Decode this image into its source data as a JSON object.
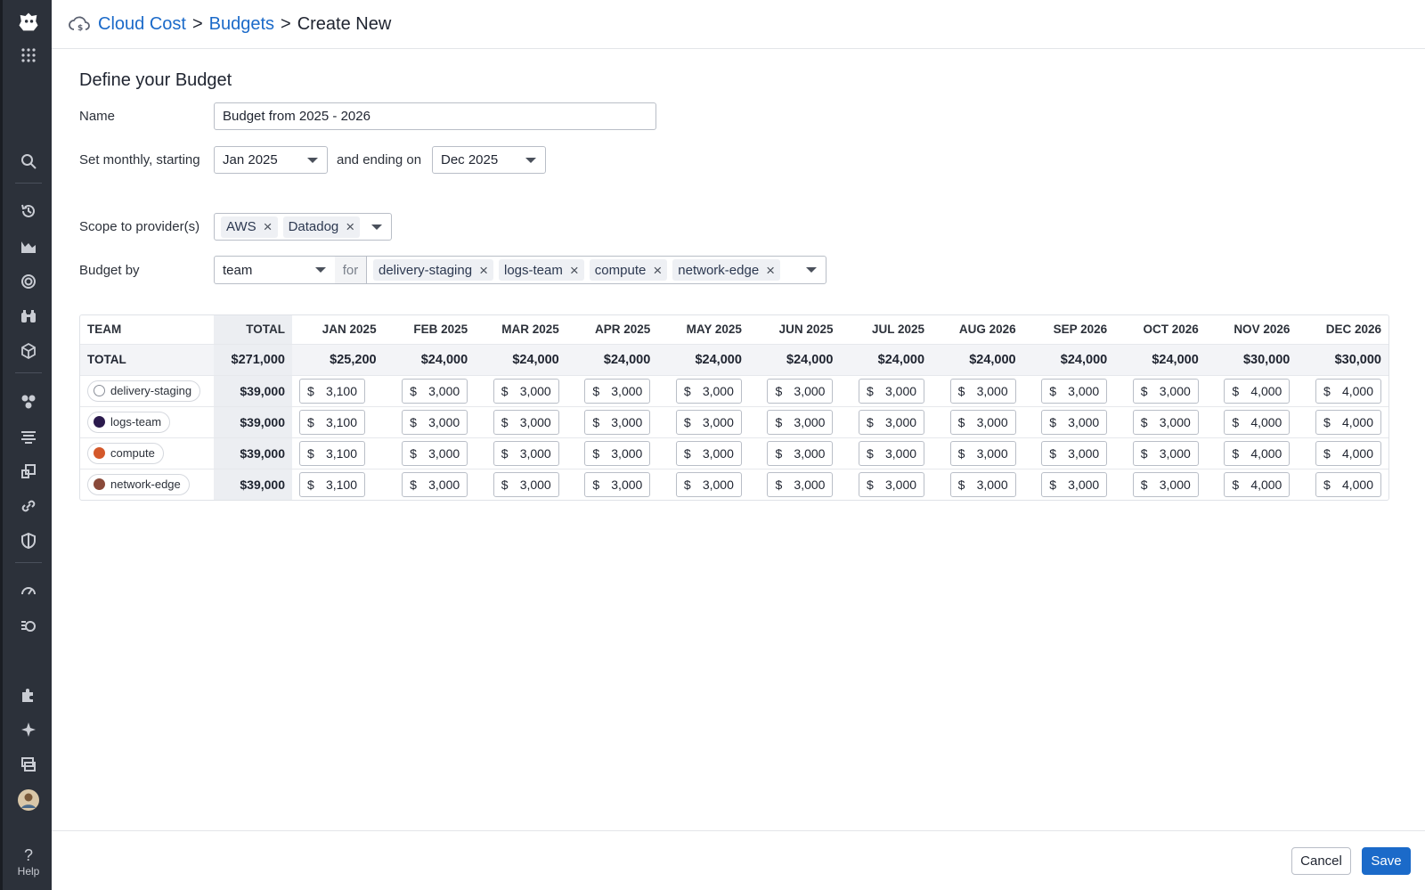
{
  "breadcrumb": {
    "root": "Cloud Cost",
    "parent": "Budgets",
    "current": "Create New",
    "separator": ">"
  },
  "form": {
    "heading": "Define your Budget",
    "name_label": "Name",
    "name_value": "Budget from 2025 - 2026",
    "monthly_label": "Set monthly, starting",
    "start_value": "Jan 2025",
    "ending_label": "and ending on",
    "end_value": "Dec 2025",
    "scope_label": "Scope to provider(s)",
    "providers": [
      "AWS",
      "Datadog"
    ],
    "budget_by_label": "Budget by",
    "budget_by_value": "team",
    "for_label": "for",
    "teams": [
      "delivery-staging",
      "logs-team",
      "compute",
      "network-edge"
    ]
  },
  "table": {
    "team_header": "TEAM",
    "total_header": "TOTAL",
    "months": [
      "JAN 2025",
      "FEB 2025",
      "MAR 2025",
      "APR 2025",
      "MAY 2025",
      "JUN 2025",
      "JUL 2025",
      "AUG 2026",
      "SEP 2026",
      "OCT 2026",
      "NOV 2026",
      "DEC 2026"
    ],
    "total_row": {
      "label": "TOTAL",
      "total": "$271,000",
      "values": [
        "$25,200",
        "$24,000",
        "$24,000",
        "$24,000",
        "$24,000",
        "$24,000",
        "$24,000",
        "$24,000",
        "$24,000",
        "$24,000",
        "$30,000",
        "$30,000"
      ]
    },
    "currency": "$",
    "rows": [
      {
        "team": "delivery-staging",
        "color": "#ffffff",
        "total": "$39,000",
        "values": [
          "3,100",
          "3,000",
          "3,000",
          "3,000",
          "3,000",
          "3,000",
          "3,000",
          "3,000",
          "3,000",
          "3,000",
          "4,000",
          "4,000"
        ]
      },
      {
        "team": "logs-team",
        "color": "#2b1a4d",
        "total": "$39,000",
        "values": [
          "3,100",
          "3,000",
          "3,000",
          "3,000",
          "3,000",
          "3,000",
          "3,000",
          "3,000",
          "3,000",
          "3,000",
          "4,000",
          "4,000"
        ]
      },
      {
        "team": "compute",
        "color": "#d4582a",
        "total": "$39,000",
        "values": [
          "3,100",
          "3,000",
          "3,000",
          "3,000",
          "3,000",
          "3,000",
          "3,000",
          "3,000",
          "3,000",
          "3,000",
          "4,000",
          "4,000"
        ]
      },
      {
        "team": "network-edge",
        "color": "#8a4a3a",
        "total": "$39,000",
        "values": [
          "3,100",
          "3,000",
          "3,000",
          "3,000",
          "3,000",
          "3,000",
          "3,000",
          "3,000",
          "3,000",
          "3,000",
          "4,000",
          "4,000"
        ]
      }
    ]
  },
  "buttons": {
    "cancel": "Cancel",
    "save": "Save"
  },
  "sidebar": {
    "help_label": "Help",
    "help_glyph": "?"
  }
}
